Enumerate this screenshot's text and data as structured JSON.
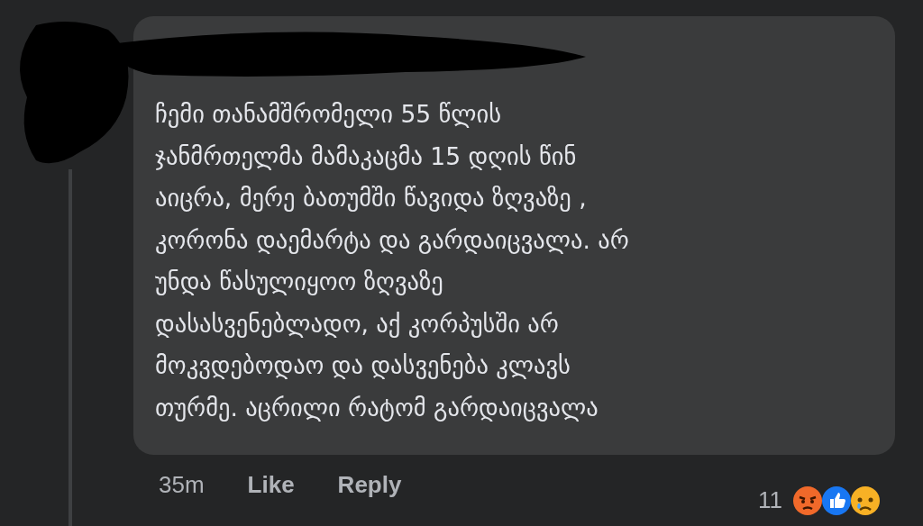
{
  "comment": {
    "text": "ჩემი თანამშრომელი 55 წლის\nჯანმრთელმა მამაკაცმა 15 დღის წინ\nაიცრა, მერე ბათუმში წავიდა ზღვაზე ,\nკორონა დაემარტა და გარდაიცვალა.  არ\nუნდა წასულიყოო ზღვაზე\nდასასვენებლადო, აქ კორპუსში არ\nმოკვდებოდაო და დასვენება კლავს\nთურმე. აცრილი რატომ გარდაიცვალა"
  },
  "footer": {
    "time": "35m",
    "actions": [
      "Like",
      "Reply"
    ],
    "reaction_count": "11",
    "reactions": [
      {
        "kind": "angry"
      },
      {
        "kind": "like"
      },
      {
        "kind": "sad"
      }
    ]
  }
}
